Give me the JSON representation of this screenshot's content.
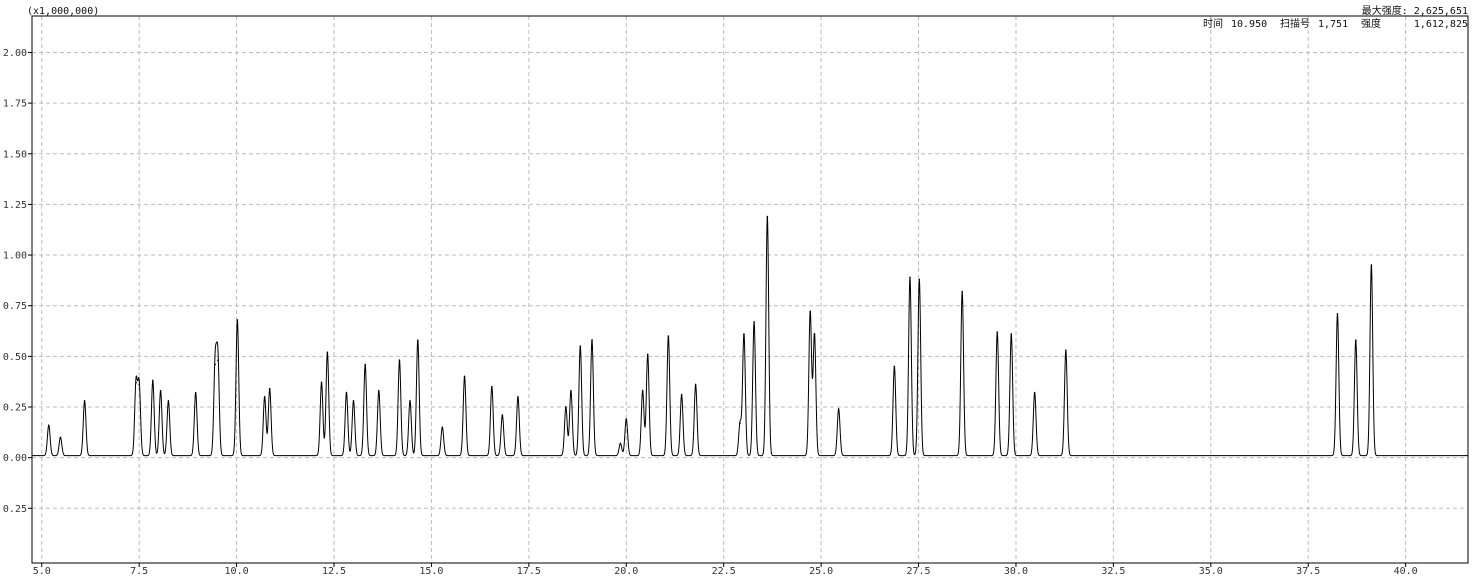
{
  "header": {
    "scale_label": "(x1,000,000)",
    "max_intensity": "最大强度: 2,625,651",
    "time_label": "时间",
    "time_value": "10.950",
    "scan_label": "扫描号",
    "scan_value": "1,751",
    "intensity_label": "强度",
    "intensity_value": "1,612,825"
  },
  "chart_data": {
    "type": "line",
    "title": "",
    "xlabel": "",
    "ylabel": "",
    "y_multiplier_label": "(x1,000,000)",
    "xlim": [
      4.75,
      41.6
    ],
    "ylim": [
      -0.52,
      2.18
    ],
    "grid": true,
    "x_ticks": [
      5.0,
      7.5,
      10.0,
      12.5,
      15.0,
      17.5,
      20.0,
      22.5,
      25.0,
      27.5,
      30.0,
      32.5,
      35.0,
      37.5,
      40.0
    ],
    "x_tick_labels": [
      "5.0",
      "7.5",
      "10.0",
      "12.5",
      "15.0",
      "17.5",
      "20.0",
      "22.5",
      "25.0",
      "27.5",
      "30.0",
      "32.5",
      "35.0",
      "37.5",
      "40.0"
    ],
    "y_ticks": [
      2.0,
      1.75,
      1.5,
      1.25,
      1.0,
      0.75,
      0.5,
      0.25,
      0.0,
      -0.25
    ],
    "y_tick_labels": [
      "2.00",
      "1.75",
      "1.50",
      "1.25",
      "1.00",
      "0.75",
      "0.50",
      "0.25",
      "0.00",
      "0.25"
    ],
    "baseline": 0.01,
    "series": [
      {
        "peaks": [
          {
            "x": 5.18,
            "y": 0.16
          },
          {
            "x": 5.48,
            "y": 0.1
          },
          {
            "x": 6.1,
            "y": 0.28
          },
          {
            "x": 7.42,
            "y": 0.37
          },
          {
            "x": 7.5,
            "y": 0.36
          },
          {
            "x": 7.85,
            "y": 0.38
          },
          {
            "x": 8.05,
            "y": 0.33
          },
          {
            "x": 8.25,
            "y": 0.28
          },
          {
            "x": 8.95,
            "y": 0.32
          },
          {
            "x": 9.45,
            "y": 0.46
          },
          {
            "x": 9.52,
            "y": 0.48
          },
          {
            "x": 10.02,
            "y": 0.68
          },
          {
            "x": 10.72,
            "y": 0.3
          },
          {
            "x": 10.85,
            "y": 0.34
          },
          {
            "x": 12.18,
            "y": 0.37
          },
          {
            "x": 12.33,
            "y": 0.52
          },
          {
            "x": 12.82,
            "y": 0.32
          },
          {
            "x": 13.0,
            "y": 0.28
          },
          {
            "x": 13.3,
            "y": 0.46
          },
          {
            "x": 13.65,
            "y": 0.33
          },
          {
            "x": 14.18,
            "y": 0.48
          },
          {
            "x": 14.45,
            "y": 0.28
          },
          {
            "x": 14.65,
            "y": 0.58
          },
          {
            "x": 15.28,
            "y": 0.15
          },
          {
            "x": 15.85,
            "y": 0.4
          },
          {
            "x": 16.55,
            "y": 0.35
          },
          {
            "x": 16.82,
            "y": 0.21
          },
          {
            "x": 17.22,
            "y": 0.3
          },
          {
            "x": 18.45,
            "y": 0.25
          },
          {
            "x": 18.58,
            "y": 0.33
          },
          {
            "x": 18.82,
            "y": 0.55
          },
          {
            "x": 19.12,
            "y": 0.58
          },
          {
            "x": 19.85,
            "y": 0.07
          },
          {
            "x": 20.0,
            "y": 0.19
          },
          {
            "x": 20.42,
            "y": 0.33
          },
          {
            "x": 20.55,
            "y": 0.51
          },
          {
            "x": 21.08,
            "y": 0.6
          },
          {
            "x": 21.42,
            "y": 0.31
          },
          {
            "x": 21.78,
            "y": 0.36
          },
          {
            "x": 22.92,
            "y": 0.17
          },
          {
            "x": 23.02,
            "y": 0.61
          },
          {
            "x": 23.28,
            "y": 0.67
          },
          {
            "x": 23.62,
            "y": 1.19
          },
          {
            "x": 24.72,
            "y": 0.72
          },
          {
            "x": 24.83,
            "y": 0.61
          },
          {
            "x": 25.45,
            "y": 0.24
          },
          {
            "x": 26.88,
            "y": 0.45
          },
          {
            "x": 27.28,
            "y": 0.89
          },
          {
            "x": 27.52,
            "y": 0.88
          },
          {
            "x": 28.62,
            "y": 0.82
          },
          {
            "x": 29.52,
            "y": 0.62
          },
          {
            "x": 29.88,
            "y": 0.61
          },
          {
            "x": 30.48,
            "y": 0.32
          },
          {
            "x": 31.28,
            "y": 0.53
          },
          {
            "x": 38.25,
            "y": 0.71
          },
          {
            "x": 38.72,
            "y": 0.58
          },
          {
            "x": 39.12,
            "y": 0.95
          }
        ]
      }
    ]
  }
}
